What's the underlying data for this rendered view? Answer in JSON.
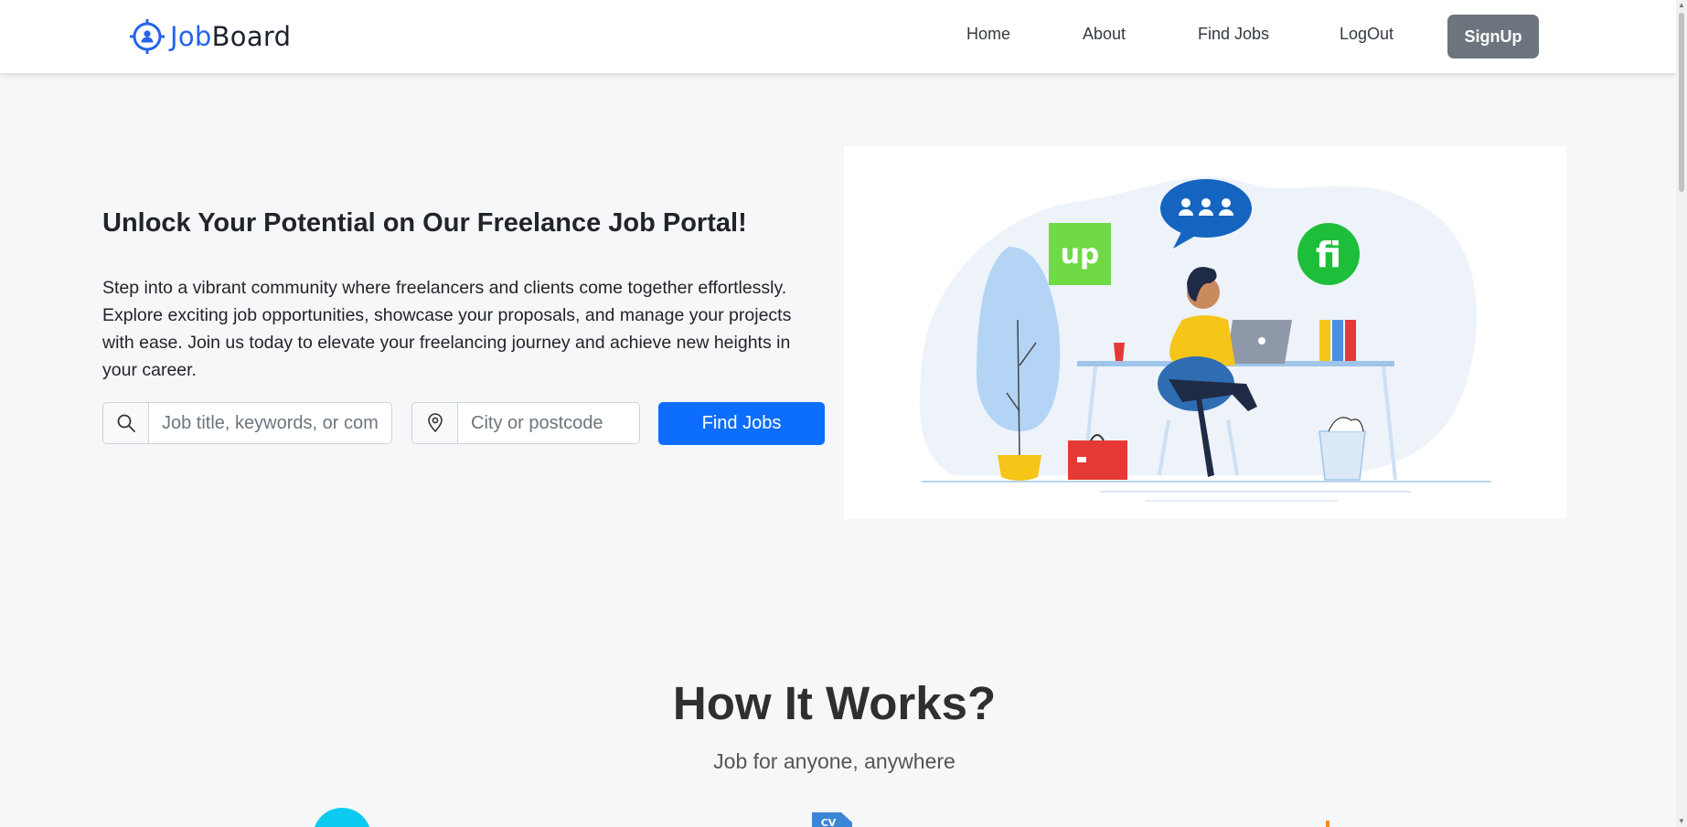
{
  "nav": {
    "brand_part1": "Job",
    "brand_part2": "Board",
    "links": [
      "Home",
      "About",
      "Find Jobs",
      "LogOut"
    ],
    "signup_label": "SignUp"
  },
  "hero": {
    "title": "Unlock Your Potential on Our Freelance Job Portal!",
    "description": "Step into a vibrant community where freelancers and clients come together effortlessly. Explore exciting job opportunities, showcase your proposals, and manage your projects with ease. Join us today to elevate your freelancing journey and achieve new heights in your career.",
    "search": {
      "keyword_placeholder": "Job title, keywords, or company",
      "keyword_value": "",
      "location_placeholder": "City or postcode",
      "location_value": "",
      "button_label": "Find Jobs"
    },
    "illustration": {
      "upwork_logo_text": "up",
      "fiverr_logo_text": "fi"
    }
  },
  "how": {
    "title": "How It Works?",
    "subtitle": "Job for anyone, anywhere",
    "step_icons": [
      "user-circle-icon",
      "cv-document-icon",
      "briefcase-icon"
    ],
    "step2_icon_text": "CV"
  },
  "colors": {
    "primary": "#0d6efd",
    "brand_blue": "#2563eb",
    "signup_gray": "#6c757d",
    "page_bg": "#f6f7f9"
  }
}
